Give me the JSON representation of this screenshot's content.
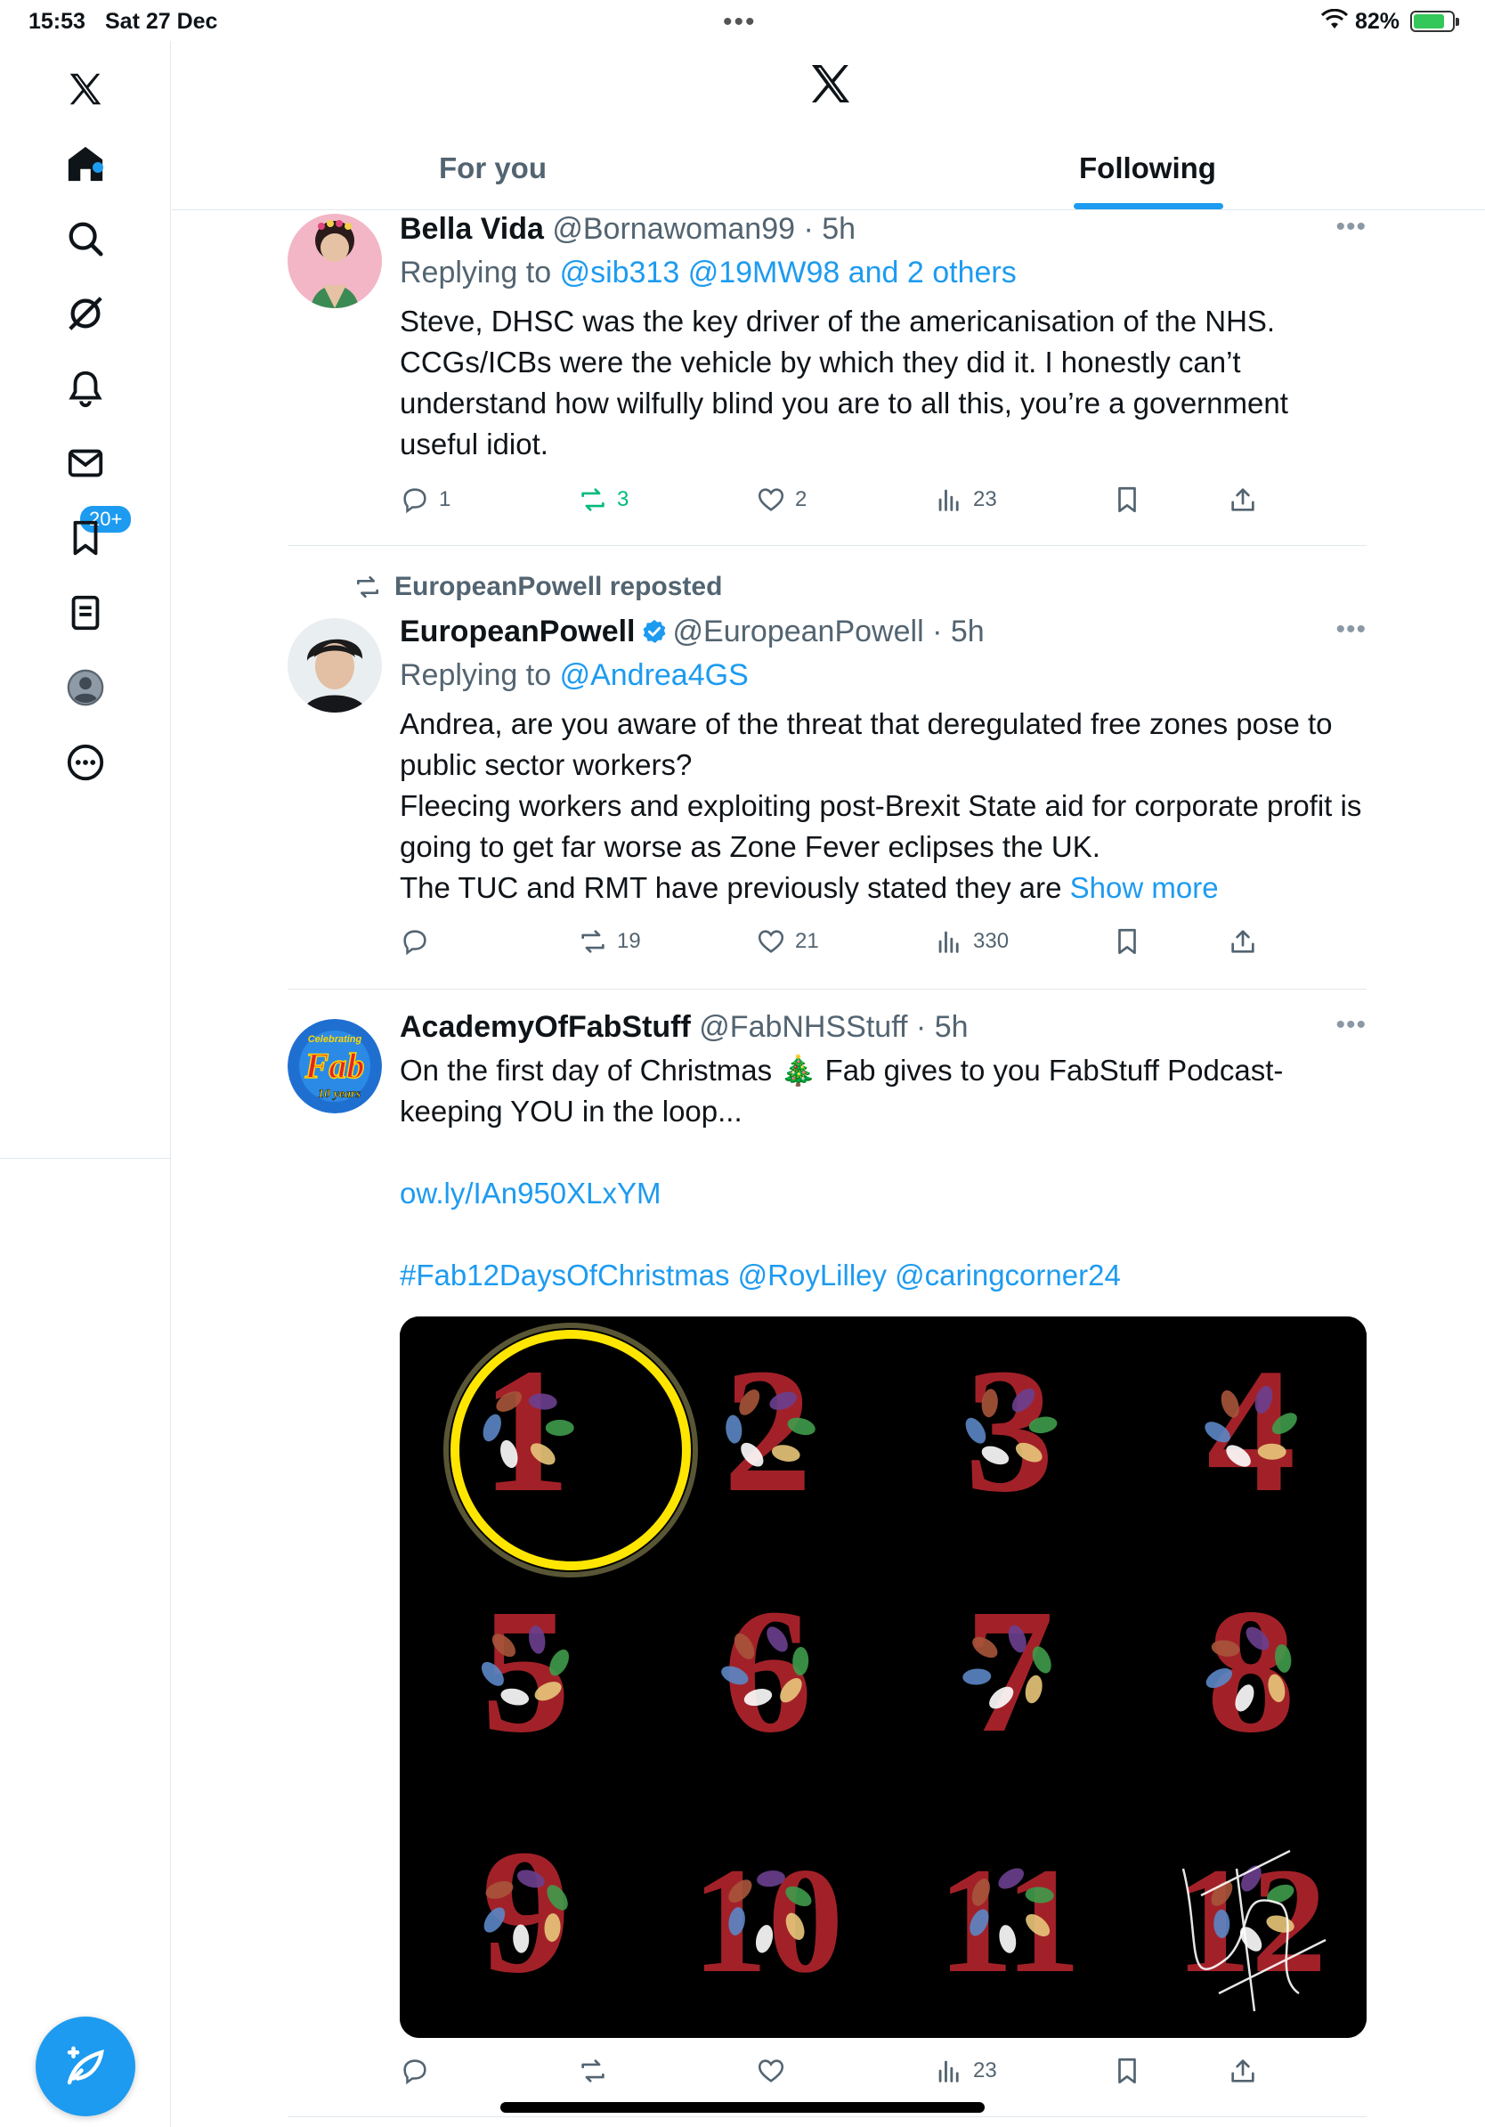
{
  "status_bar": {
    "time": "15:53",
    "date": "Sat 27 Dec",
    "battery_percent": "82%",
    "battery_level": 0.82
  },
  "sidebar": {
    "notifications_badge": "20+",
    "items": [
      "home-icon",
      "search-icon",
      "grok-icon",
      "notifications-icon",
      "messages-icon",
      "bookmarks-icon",
      "lists-icon",
      "profile-icon",
      "more-icon"
    ]
  },
  "header": {
    "tabs": [
      {
        "label": "For you",
        "active": false
      },
      {
        "label": "Following",
        "active": true
      }
    ]
  },
  "tweets": [
    {
      "name": "Bella Vida",
      "handle": "@Bornawoman99",
      "time": "5h",
      "replying_prefix": "Replying to",
      "replying_to": "@sib313 @19MW98 and 2 others",
      "text": "Steve, DHSC was the key driver of the americanisation of the NHS. CCGs/ICBs were the vehicle by which they did it. I honestly can’t understand how wilfully blind you are to all this, you’re a government useful idiot.",
      "replies": "1",
      "reposts": "3",
      "likes": "2",
      "views": "23"
    },
    {
      "reposted_by": "EuropeanPowell reposted",
      "name": "EuropeanPowell",
      "handle": "@EuropeanPowell",
      "time": "5h",
      "replying_prefix": "Replying to",
      "replying_to": "@Andrea4GS",
      "text": "Andrea, are you aware of the threat that deregulated free zones pose to public sector workers?\nFleecing workers and exploiting post-Brexit State aid for corporate profit is going to get far worse as Zone Fever eclipses the UK.\nThe TUC and RMT have previously stated they are",
      "show_more": "Show more",
      "replies": "",
      "reposts": "19",
      "likes": "21",
      "views": "330"
    },
    {
      "name": "AcademyOfFabStuff",
      "handle": "@FabNHSStuff",
      "time": "5h",
      "text": "On the first day of Christmas 🎄 Fab gives to you FabStuff Podcast- keeping YOU in the loop...",
      "link": "ow.ly/IAn950XLxYM",
      "hashtags": "#Fab12DaysOfChristmas @RoyLilley @caringcorner24",
      "avatar_text": [
        "Celebrating",
        "Fab",
        "10 years"
      ],
      "media_numbers": [
        "1",
        "2",
        "3",
        "4",
        "5",
        "6",
        "7",
        "8",
        "9",
        "10",
        "11",
        "12"
      ],
      "replies": "",
      "reposts": "",
      "likes": "",
      "views": "23"
    }
  ],
  "colors": {
    "accent": "#1d9bf0",
    "repost_green": "#00ba7c",
    "text_secondary": "#536471",
    "number_red": "#b0242c",
    "highlight_yellow": "#ffe600"
  }
}
